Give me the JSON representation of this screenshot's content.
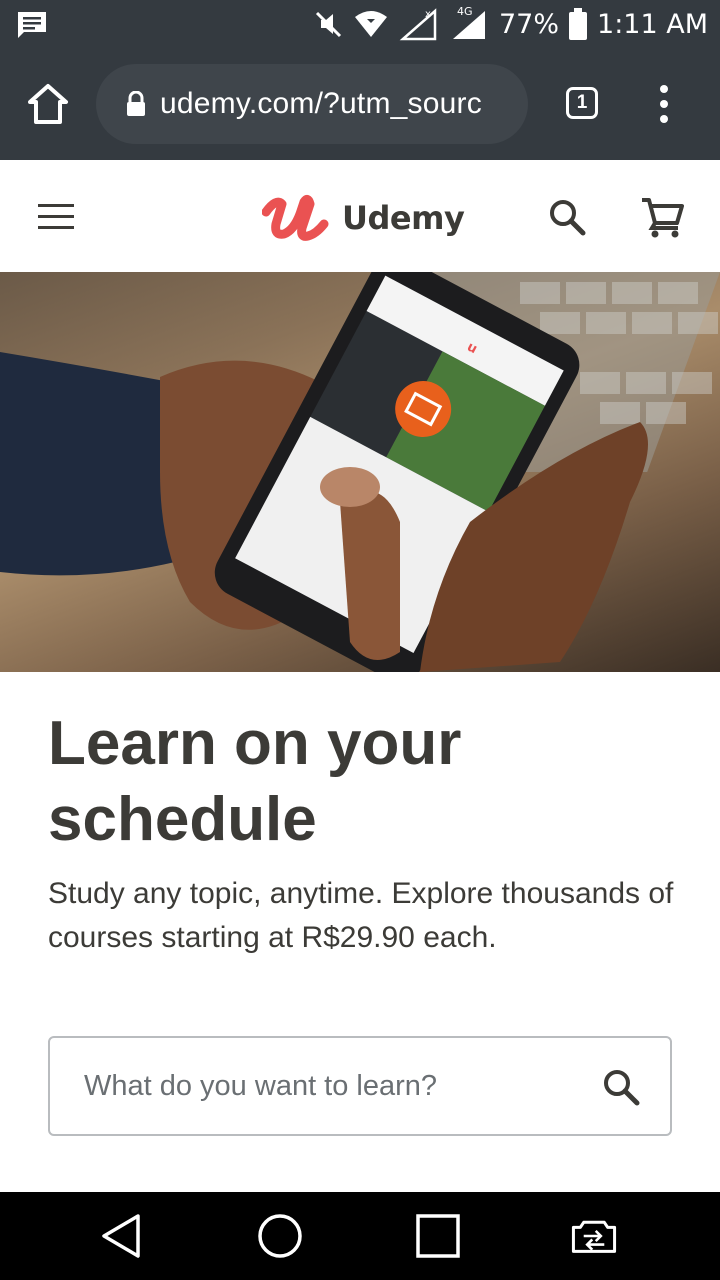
{
  "status_bar": {
    "battery_percent": "77%",
    "time": "1:11 AM",
    "network_label": "4G",
    "icons": [
      "message-icon",
      "mute-icon",
      "wifi-icon",
      "signal-icon",
      "battery-icon"
    ]
  },
  "browser": {
    "url": "udemy.com/?utm_sourc",
    "tab_count": "1",
    "icons": [
      "home-icon",
      "lock-icon",
      "tabs-icon",
      "more-icon"
    ]
  },
  "site_header": {
    "logo_text": "Udemy",
    "icons": [
      "hamburger-icon",
      "search-icon",
      "cart-icon"
    ]
  },
  "hero": {
    "headline": "Learn on your schedule",
    "subtext": "Study any topic, anytime. Explore thousands of courses starting at R$29.90 each."
  },
  "search": {
    "placeholder": "What do you want to learn?"
  },
  "nav_bar": {
    "icons": [
      "back-icon",
      "home-circle-icon",
      "recents-icon",
      "screen-switch-icon"
    ]
  },
  "colors": {
    "chrome_bg": "#343a40",
    "url_pill": "#3f454b",
    "brand_red": "#ea5252",
    "text_dark": "#3c3b37"
  }
}
